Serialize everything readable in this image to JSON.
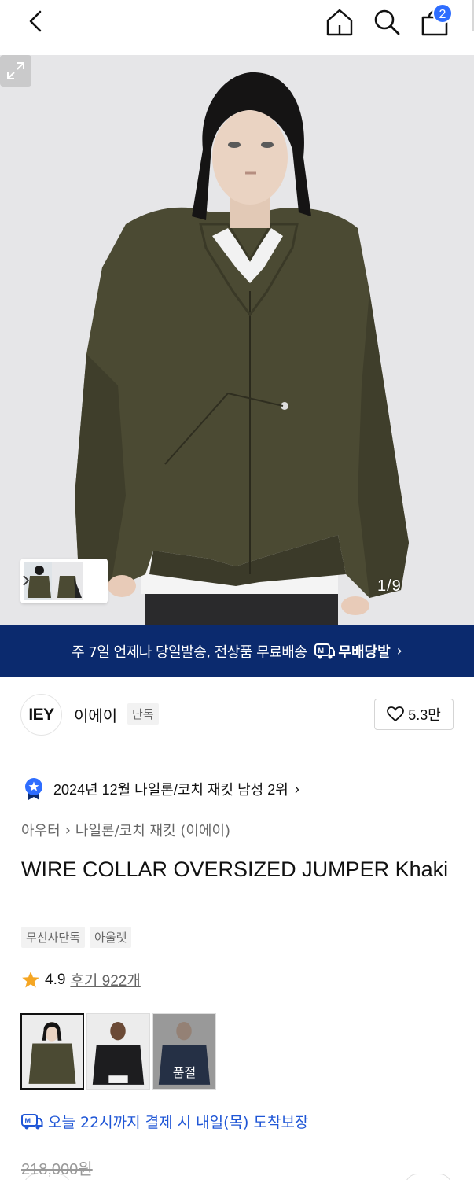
{
  "header": {
    "cart_count": "2"
  },
  "gallery": {
    "counter": "1/9"
  },
  "shipping_banner": {
    "text": "주 7일 언제나 당일발송, 전상품 무료배송",
    "logo_label": "무배당발",
    "chevron": "›"
  },
  "brand": {
    "logo_text": "IEY",
    "name": "이에이",
    "tag": "단독",
    "likes": "5.3만"
  },
  "ranking": {
    "text": "2024년 12월 나일론/코치 재킷 남성 2위",
    "chevron": "›"
  },
  "breadcrumb": {
    "category": "아우터",
    "separator": "›",
    "subcategory": "나일론/코치 재킷 (이에이)"
  },
  "product": {
    "title": "WIRE COLLAR OVERSIZED JUMPER Khaki",
    "tags": [
      "무신사단독",
      "아울렛"
    ],
    "rating": "4.9",
    "reviews": "후기 922개",
    "original_price": "218,000원"
  },
  "variants": [
    {
      "color": "#4b4a33",
      "selected": true,
      "label": ""
    },
    {
      "color": "#1d1d1f",
      "selected": false,
      "label": ""
    },
    {
      "color": "#3a4a6a",
      "selected": false,
      "label": "품절"
    }
  ],
  "delivery": {
    "text": "오늘 22시까지 결제 시 내일(목) 도착보장"
  },
  "colors": {
    "banner_bg": "#0b2a6e",
    "accent_blue": "#2e6dff",
    "delivery_blue": "#1f56d6",
    "star": "#f5a623",
    "jacket_khaki": "#4b4a33"
  }
}
